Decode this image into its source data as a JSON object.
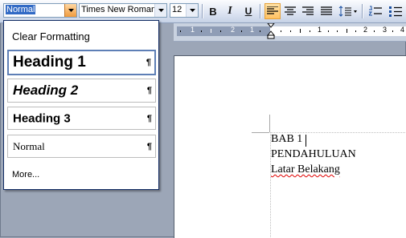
{
  "toolbar": {
    "style_value": "Normal",
    "font_value": "Times New Roman",
    "size_value": "12",
    "bold_label": "B",
    "italic_label": "I",
    "underline_label": "U"
  },
  "ruler": {
    "numbers": [
      "1",
      "2",
      "1",
      "1",
      "2",
      "3",
      "4"
    ]
  },
  "styles_menu": {
    "clear_label": "Clear Formatting",
    "items": [
      {
        "label": "Heading 1",
        "mark": "¶"
      },
      {
        "label": "Heading 2",
        "mark": "¶"
      },
      {
        "label": "Heading 3",
        "mark": "¶"
      },
      {
        "label": "Normal",
        "mark": "¶"
      }
    ],
    "more_label": "More..."
  },
  "document": {
    "lines": [
      "BAB 1",
      "PENDAHULUAN",
      "Latar Belakang"
    ]
  },
  "colors": {
    "active_button": "#ffc262",
    "selection": "#316ac5",
    "spelling_error": "#e00000"
  }
}
